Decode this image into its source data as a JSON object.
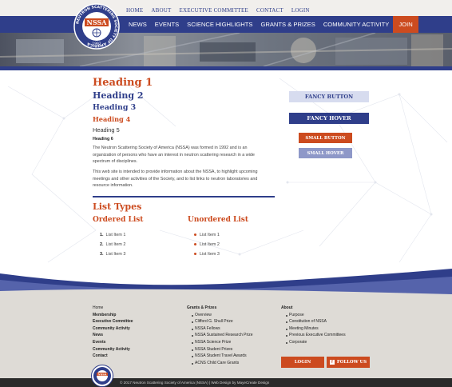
{
  "header": {
    "logo_text": "NSSA",
    "logo_ring_text": "NEUTRON SCATTERING SOCIETY OF AMERICA",
    "logo_year": "1992",
    "top_nav": [
      "HOME",
      "ABOUT",
      "EXECUTIVE COMMITTEE",
      "CONTACT",
      "LOGIN"
    ],
    "main_nav": [
      "NEWS",
      "EVENTS",
      "SCIENCE HIGHLIGHTS",
      "GRANTS & PRIZES",
      "COMMUNITY ACTIVITY"
    ],
    "join_label": "JOIN"
  },
  "content": {
    "h1": "Heading 1",
    "h2": "Heading 2",
    "h3": "Heading 3",
    "h4": "Heading 4",
    "h5": "Heading 5",
    "h6": "Heading 6",
    "para1": "The Neutron Scattering Society of America (NSSA) was formed in 1992 and is an organization of persons who have an interest in neutron scattering research in a wide spectrum of disciplines.",
    "para2": "This web site is intended to provide information about the NSSA, to highlight upcoming meetings and other activities of the Society, and to list links to neutron laboratories and resource information.",
    "list_types": "List Types",
    "ordered_title": "Ordered List",
    "unordered_title": "Unordered List",
    "ordered_items": [
      {
        "num": "1.",
        "label": "List Item 1"
      },
      {
        "num": "2.",
        "label": "List Item 2"
      },
      {
        "num": "3.",
        "label": "List Item 3"
      }
    ],
    "unordered_items": [
      "List Item 1",
      "List Item 2",
      "List Item 3"
    ],
    "fancy_button": "FANCY BUTTON",
    "fancy_hover": "FANCY HOVER",
    "small_button": "SMALL BUTTON",
    "small_hover": "SMALL HOVER"
  },
  "footer": {
    "col1": [
      "Home",
      "Membership",
      "Executive Committee",
      "Community Activity",
      "News",
      "Events",
      "Community Activity",
      "Contact"
    ],
    "col2_title": "Grants & Prizes",
    "col2": [
      "Overview",
      "Clifford G. Shull Prize",
      "NSSA Fellows",
      "NSSA Sustained Research Prize",
      "NSSA Science Prize",
      "NSSA Student Prizes",
      "NSSA Student Travel Awards",
      "ACNS Child Care Grants"
    ],
    "col3_title": "About",
    "col3": [
      "Purpose",
      "Constitution of NSSA",
      "Meeting Minutes",
      "Previous Executive Committees",
      "Corporate"
    ],
    "login_label": "LOGIN",
    "follow_label": "FOLLOW US",
    "fb_glyph": "f",
    "copyright": "© 2017 Neutron Scattering Society of America (NSSA) | Web Design by MayeCreate Design"
  },
  "colors": {
    "navy": "#2f3e8a",
    "orange": "#cc4b1f",
    "light_blue": "#d7dcef",
    "footer_bg": "#dedbd6"
  }
}
